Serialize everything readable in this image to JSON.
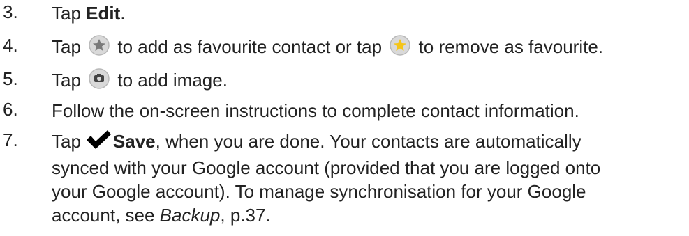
{
  "steps": [
    {
      "number": "3.",
      "parts": {
        "a": "Tap ",
        "b": "Edit",
        "c": "."
      }
    },
    {
      "number": "4.",
      "parts": {
        "a": "Tap",
        "b": "to add as favourite contact or tap",
        "c": "to remove as favourite."
      },
      "icons": [
        "star-outline-icon",
        "star-filled-icon"
      ]
    },
    {
      "number": "5.",
      "parts": {
        "a": "Tap",
        "b": "to add image."
      },
      "icons": [
        "camera-icon"
      ]
    },
    {
      "number": "6.",
      "parts": {
        "a": "Follow the on-screen instructions to complete contact information."
      }
    },
    {
      "number": "7.",
      "parts": {
        "a": "Tap",
        "b": "Save",
        "c": ", when you are done. Your contacts are automatically",
        "line2": "synced with your Google account (provided that you are logged onto",
        "line3": "your Google account). To manage synchronisation for your Google",
        "line4_a": "account, see ",
        "line4_b": "Backup",
        "line4_c": ", p.37."
      },
      "icons": [
        "checkmark-icon"
      ]
    }
  ],
  "colors": {
    "text": "#222222",
    "icon_bg": "#d9d9d9",
    "icon_ring": "#b8b8b8",
    "star_grey": "#7a7a7a",
    "star_yellow": "#f5c518"
  }
}
